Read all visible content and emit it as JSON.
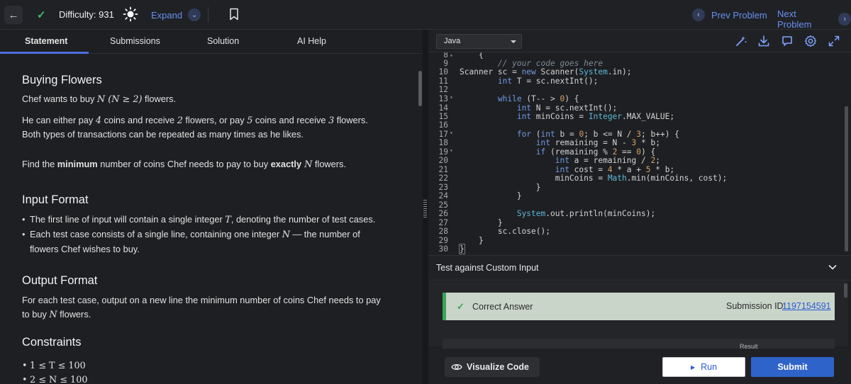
{
  "topbar": {
    "difficulty": "Difficulty: 931",
    "expand_label": "Expand",
    "prev_label": "Prev Problem",
    "next_label": "Next Problem"
  },
  "tabs": [
    {
      "label": "Statement",
      "active": true
    },
    {
      "label": "Submissions"
    },
    {
      "label": "Solution"
    },
    {
      "label": "AI Help"
    }
  ],
  "statement": {
    "title": "Buying Flowers",
    "intro_a": "Chef wants to buy ",
    "intro_math": "N (N ≥ 2)",
    "intro_b": " flowers.",
    "p2_a": "He can either pay ",
    "p2_n1": "4",
    "p2_b": " coins and receive ",
    "p2_n2": "2",
    "p2_c": " flowers, or pay ",
    "p2_n3": "5",
    "p2_d": " coins and receive ",
    "p2_n4": "3",
    "p2_e": " flowers.",
    "p3": "Both types of transactions can be repeated as many times as he likes.",
    "p4_a": "Find the ",
    "p4_b": "minimum",
    "p4_c": " number of coins Chef needs to pay to buy ",
    "p4_d": "exactly",
    "p4_e": " N",
    "p4_f": " flowers.",
    "input_title": "Input Format",
    "input_b1_a": "The first line of input will contain a single integer ",
    "input_b1_m": "T",
    "input_b1_b": ", denoting the number of test cases.",
    "input_b2_a": "Each test case consists of a single line, containing one integer ",
    "input_b2_m": "N",
    "input_b2_b": " — the number of flowers Chef wishes to buy.",
    "output_title": "Output Format",
    "output_text": "For each test case, output on a new line the minimum number of coins Chef needs to pay to buy ",
    "output_m": "N",
    "output_end": " flowers.",
    "constraints_title": "Constraints",
    "c1": "1 ≤ T ≤ 100",
    "c2": "2 ≤ N ≤ 100"
  },
  "editor": {
    "language": "Java",
    "line_numbers": [
      "8",
      "9",
      "10",
      "11",
      "12",
      "13",
      "14",
      "15",
      "16",
      "17",
      "18",
      "19",
      "20",
      "21",
      "22",
      "23",
      "24",
      "25",
      "26",
      "27",
      "28",
      "29",
      "30"
    ]
  },
  "custom_input_label": "Test against Custom Input",
  "result": {
    "status": "Correct Answer",
    "submission_label": "Submission ID:",
    "submission_id": "1197154591",
    "result_label": "Result"
  },
  "buttons": {
    "visualize": "Visualize Code",
    "run": "Run",
    "submit": "Submit"
  },
  "colors": {
    "accent_blue": "#2e63c9",
    "link_blue": "#6a8ff0",
    "success_green": "#3aa55a",
    "correct_bg": "#c9d5c9"
  }
}
